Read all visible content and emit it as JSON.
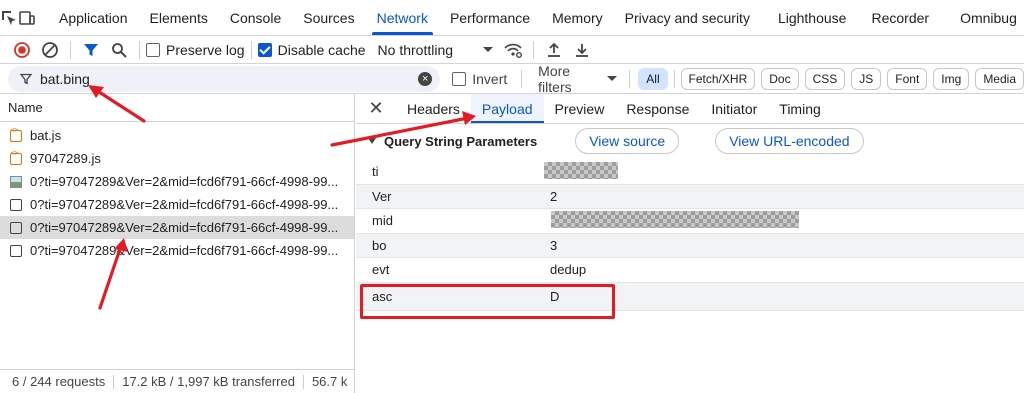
{
  "tabs": [
    "Application",
    "Elements",
    "Console",
    "Sources",
    "Network",
    "Performance",
    "Memory",
    "Privacy and security",
    "Lighthouse",
    "Recorder",
    "Omnibug"
  ],
  "active_tab": "Network",
  "toolbar": {
    "preserve_log": "Preserve log",
    "disable_cache": "Disable cache",
    "throttling": "No throttling"
  },
  "filter": {
    "value": "bat.bing",
    "invert": "Invert",
    "more_filters": "More filters",
    "chips": [
      "All",
      "Fetch/XHR",
      "Doc",
      "CSS",
      "JS",
      "Font",
      "Img",
      "Media"
    ]
  },
  "requests": {
    "header": "Name",
    "rows": [
      {
        "name": "bat.js",
        "type": "script"
      },
      {
        "name": "97047289.js",
        "type": "script"
      },
      {
        "name": "0?ti=97047289&Ver=2&mid=fcd6f791-66cf-4998-99...",
        "type": "img"
      },
      {
        "name": "0?ti=97047289&Ver=2&mid=fcd6f791-66cf-4998-99...",
        "type": "doc"
      },
      {
        "name": "0?ti=97047289&Ver=2&mid=fcd6f791-66cf-4998-99...",
        "type": "doc"
      },
      {
        "name": "0?ti=97047289&Ver=2&mid=fcd6f791-66cf-4998-99...",
        "type": "doc"
      }
    ],
    "footer": {
      "count": "6 / 244 requests",
      "transferred": "17.2 kB / 1,997 kB transferred",
      "resources": "56.7 k"
    }
  },
  "details": {
    "tabs": [
      "Headers",
      "Payload",
      "Preview",
      "Response",
      "Initiator",
      "Timing"
    ],
    "active_tab": "Payload",
    "section_title": "Query String Parameters",
    "view_source": "View source",
    "view_url_encoded": "View URL-encoded",
    "params": [
      {
        "key": "ti",
        "value": ""
      },
      {
        "key": "Ver",
        "value": "2"
      },
      {
        "key": "mid",
        "value": ""
      },
      {
        "key": "bo",
        "value": "3"
      },
      {
        "key": "evt",
        "value": "dedup"
      },
      {
        "key": "asc",
        "value": "D"
      }
    ]
  },
  "colors": {
    "accent": "#0b57d0",
    "annotation": "#e41b23",
    "selected_row": "#dcdcdc"
  }
}
